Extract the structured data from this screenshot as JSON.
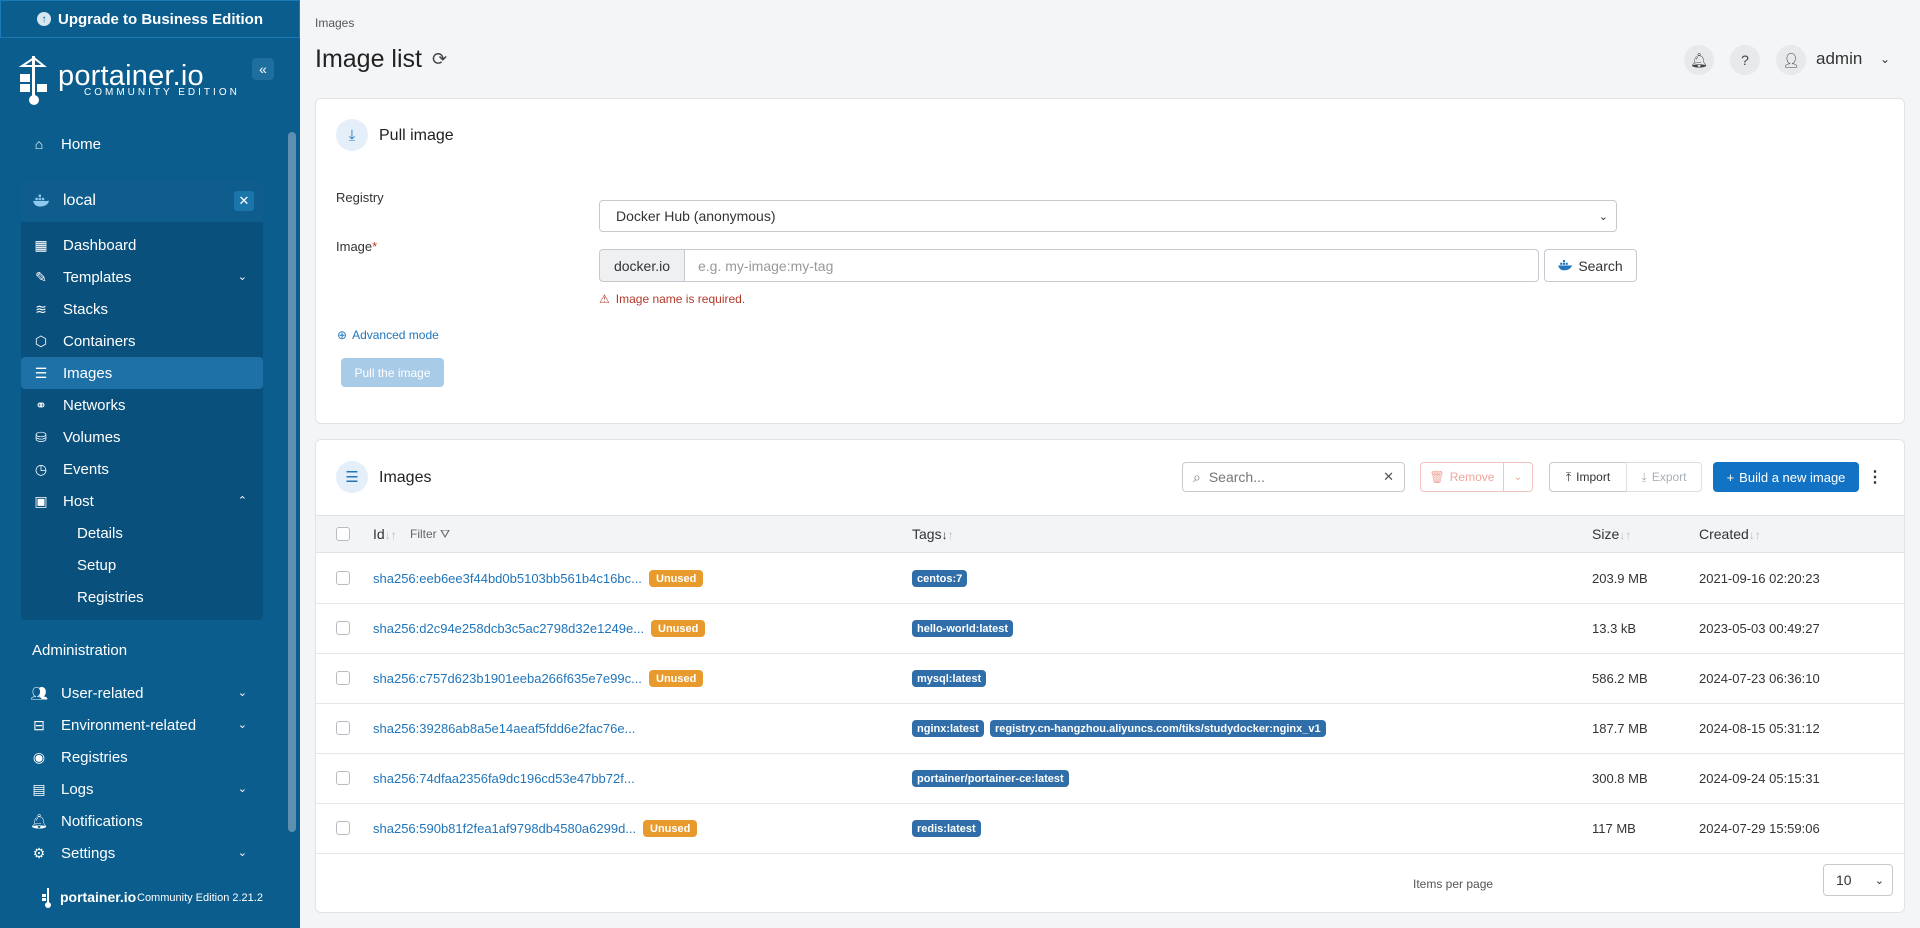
{
  "sidebar": {
    "upgrade": "Upgrade to Business Edition",
    "brand_name": "portainer.io",
    "brand_sub": "COMMUNITY EDITION",
    "home": "Home",
    "environment": "local",
    "env_items": [
      "Dashboard",
      "Templates",
      "Stacks",
      "Containers",
      "Images",
      "Networks",
      "Volumes",
      "Events",
      "Host"
    ],
    "host_sub": [
      "Details",
      "Setup",
      "Registries"
    ],
    "admin_heading": "Administration",
    "admin_items": [
      "User-related",
      "Environment-related",
      "Registries",
      "Logs",
      "Notifications",
      "Settings"
    ],
    "footer_brand": "portainer.io",
    "footer_version": "Community Edition 2.21.2"
  },
  "header": {
    "breadcrumb": "Images",
    "title": "Image list",
    "user": "admin"
  },
  "pull": {
    "title": "Pull image",
    "registry_label": "Registry",
    "registry_value": "Docker Hub (anonymous)",
    "image_label": "Image",
    "required_mark": "*",
    "prefix": "docker.io",
    "placeholder": "e.g. my-image:my-tag",
    "search_label": "Search",
    "error": "Image name is required.",
    "advanced": "Advanced mode",
    "pull_button": "Pull the image"
  },
  "images": {
    "title": "Images",
    "search_placeholder": "Search...",
    "remove": "Remove",
    "import": "Import",
    "export": "Export",
    "build": "Build a new image",
    "col_id": "Id",
    "filter": "Filter",
    "col_tags": "Tags",
    "col_size": "Size",
    "col_created": "Created",
    "unused_label": "Unused",
    "rows": [
      {
        "id": "sha256:eeb6ee3f44bd0b5103bb561b4c16bc...",
        "unused": true,
        "tags": [
          "centos:7"
        ],
        "size": "203.9 MB",
        "created": "2021-09-16 02:20:23"
      },
      {
        "id": "sha256:d2c94e258dcb3c5ac2798d32e1249e...",
        "unused": true,
        "tags": [
          "hello-world:latest"
        ],
        "size": "13.3 kB",
        "created": "2023-05-03 00:49:27"
      },
      {
        "id": "sha256:c757d623b1901eeba266f635e7e99c...",
        "unused": true,
        "tags": [
          "mysql:latest"
        ],
        "size": "586.2 MB",
        "created": "2024-07-23 06:36:10"
      },
      {
        "id": "sha256:39286ab8a5e14aeaf5fdd6e2fac76e...",
        "unused": false,
        "tags": [
          "nginx:latest",
          "registry.cn-hangzhou.aliyuncs.com/tiks/studydocker:nginx_v1"
        ],
        "size": "187.7 MB",
        "created": "2024-08-15 05:31:12"
      },
      {
        "id": "sha256:74dfaa2356fa9dc196cd53e47bb72f...",
        "unused": false,
        "tags": [
          "portainer/portainer-ce:latest"
        ],
        "size": "300.8 MB",
        "created": "2024-09-24 05:15:31"
      },
      {
        "id": "sha256:590b81f2fea1af9798db4580a6299d...",
        "unused": true,
        "tags": [
          "redis:latest"
        ],
        "size": "117 MB",
        "created": "2024-07-29 15:59:06"
      }
    ],
    "items_per_page_label": "Items per page",
    "items_per_page": "10"
  },
  "colors": {
    "sidebar_bg": "#0b5d8e",
    "primary": "#1273c4",
    "unused_badge": "#e99a2c",
    "tag_badge": "#2f6ea8"
  }
}
